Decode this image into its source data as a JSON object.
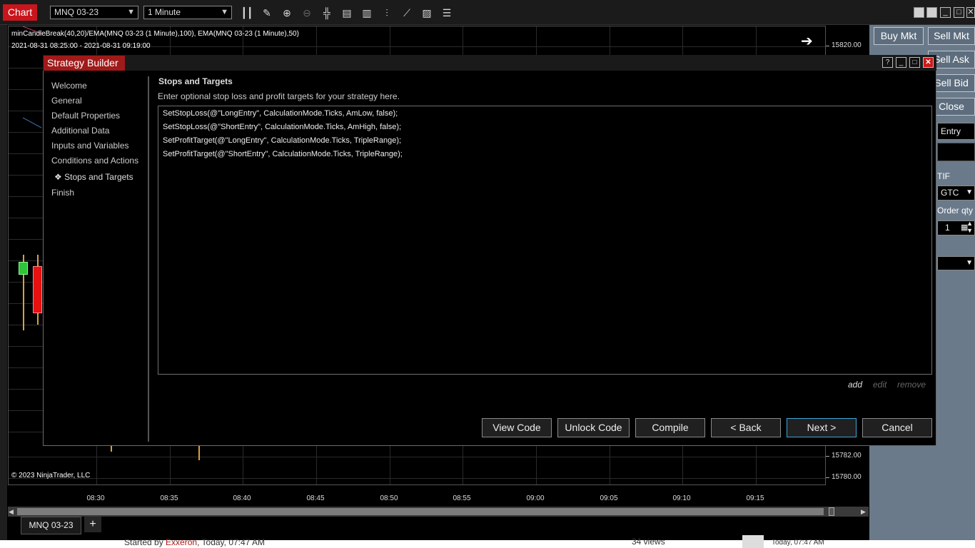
{
  "toolbar": {
    "chart_tab": "Chart",
    "instrument": "MNQ 03-23",
    "interval": "1 Minute"
  },
  "chart": {
    "indicator_label": "minCandleBreak(40,20)/EMA(MNQ 03-23 (1 Minute),100), EMA(MNQ 03-23 (1 Minute),50)",
    "range_label": "2021-08-31 08:25:00 - 2021-08-31 09:19:00",
    "copyright": "© 2023 NinjaTrader, LLC",
    "y_labels": [
      "15820.00",
      "15782.00",
      "15780.00"
    ],
    "x_labels": [
      "08:30",
      "08:35",
      "08:40",
      "08:45",
      "08:50",
      "08:55",
      "09:00",
      "09:05",
      "09:10",
      "09:15"
    ],
    "symbol_tab": "MNQ 03-23",
    "add_tab": "+"
  },
  "order_panel": {
    "buy_mkt": "Buy Mkt",
    "sell_mkt": "Sell Mkt",
    "sell_ask": "Sell Ask",
    "sell_bid": "Sell Bid",
    "close": "Close",
    "entry": "Entry",
    "tif_label": "TIF",
    "tif_value": "GTC",
    "order_qty_label": "Order qty",
    "order_qty_value": "1"
  },
  "forum": {
    "started_by": "Started by",
    "author": "Exxeron",
    "time": ", Today, 07:47 AM",
    "views": "34 views",
    "last_post": "Today, 07:47 AM"
  },
  "dialog": {
    "title": "Strategy Builder",
    "nav": [
      "Welcome",
      "General",
      "Default Properties",
      "Additional Data",
      "Inputs and Variables",
      "Conditions and Actions",
      "Stops and Targets",
      "Finish"
    ],
    "active_nav_marker": "❖",
    "section_title": "Stops and Targets",
    "section_desc": "Enter optional stop loss and profit targets for your strategy here.",
    "code_lines": [
      "SetStopLoss(@\"LongEntry\", CalculationMode.Ticks, AmLow, false);",
      "SetStopLoss(@\"ShortEntry\", CalculationMode.Ticks, AmHigh, false);",
      "SetProfitTarget(@\"LongEntry\", CalculationMode.Ticks, TripleRange);",
      "SetProfitTarget(@\"ShortEntry\", CalculationMode.Ticks, TripleRange);"
    ],
    "actions": {
      "add": "add",
      "edit": "edit",
      "remove": "remove"
    },
    "buttons": {
      "view_code": "View Code",
      "unlock_code": "Unlock Code",
      "compile": "Compile",
      "back": "< Back",
      "next": "Next >",
      "cancel": "Cancel"
    }
  }
}
